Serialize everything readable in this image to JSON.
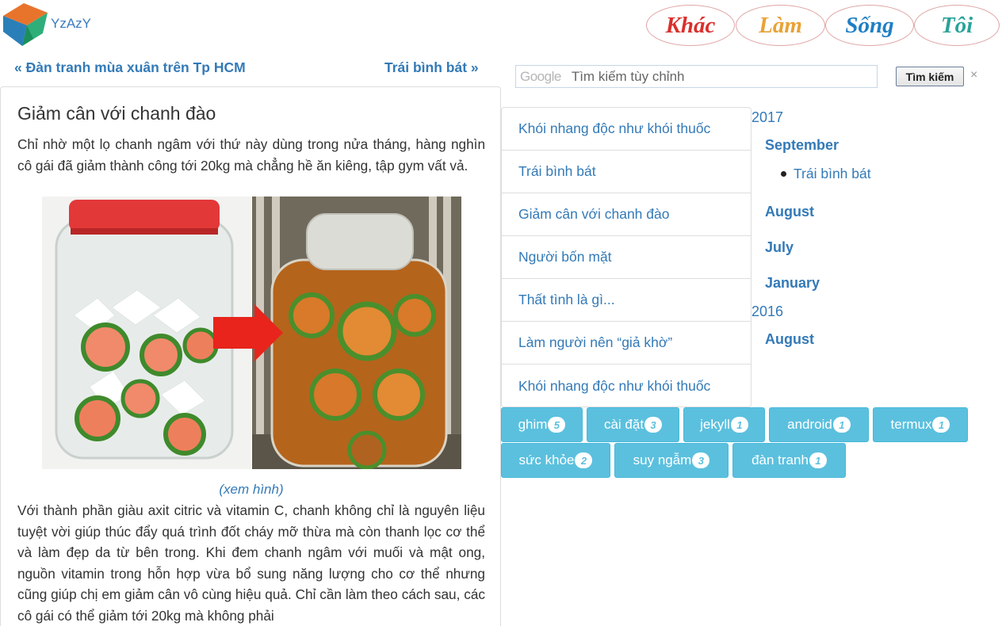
{
  "site": {
    "logo_text": "YzAzY"
  },
  "nav": [
    {
      "label": "Khác",
      "color": "#d9302c"
    },
    {
      "label": "Làm",
      "color": "#e9a235"
    },
    {
      "label": "Sống",
      "color": "#1f7fc4"
    },
    {
      "label": "Tôi",
      "color": "#2aa39a"
    }
  ],
  "post_nav": {
    "prev": "« Đàn tranh mùa xuân trên Tp HCM",
    "next": "Trái bình bát »"
  },
  "article": {
    "title": "Giảm cân với chanh đào",
    "intro": "Chỉ nhờ một lọ chanh ngâm với thứ này dùng trong nửa tháng, hàng nghìn cô gái đã giảm thành công tới 20kg mà chẳng hề ăn kiêng, tập gym vất vả.",
    "caption": "(xem hình)",
    "body": "Với thành phần giàu axit citric và vitamin C, chanh không chỉ là nguyên liệu tuyệt vời giúp thúc đẩy quá trình đốt cháy mỡ thừa mà còn thanh lọc cơ thể và làm đẹp da từ bên trong. Khi đem chanh ngâm với muối và mật ong, nguồn vitamin trong hỗn hợp vừa bổ sung năng lượng cho cơ thể nhưng cũng giúp chị em giảm cân vô cùng hiệu quả. Chỉ cần làm theo cách sau, các cô gái có thể giảm tới 20kg mà không phải"
  },
  "search": {
    "brand": "Google",
    "placeholder": "Tìm kiếm tùy chỉnh",
    "button": "Tìm kiếm",
    "clear": "×"
  },
  "popular_posts": [
    "Khói nhang độc như khói thuốc",
    "Trái bình bát",
    "Giảm cân với chanh đào",
    "Người bốn mặt",
    "Thất tình là gì...",
    "Làm người nên “giả khờ”",
    "Khói nhang độc như khói thuốc"
  ],
  "archive": {
    "y2017": "2017",
    "m_sep": "September",
    "post_sep": "Trái bình bát",
    "m_aug": "August",
    "m_jul": "July",
    "m_jan": "January",
    "y2016": "2016",
    "m_aug16": "August"
  },
  "tags": [
    {
      "name": "ghim",
      "count": "5"
    },
    {
      "name": "cài đặt",
      "count": "3"
    },
    {
      "name": "jekyll",
      "count": "1"
    },
    {
      "name": "android",
      "count": "1"
    },
    {
      "name": "termux",
      "count": "1"
    },
    {
      "name": "sức khỏe",
      "count": "2"
    },
    {
      "name": "suy ngẫm",
      "count": "3"
    },
    {
      "name": "đàn tranh",
      "count": "1"
    }
  ]
}
